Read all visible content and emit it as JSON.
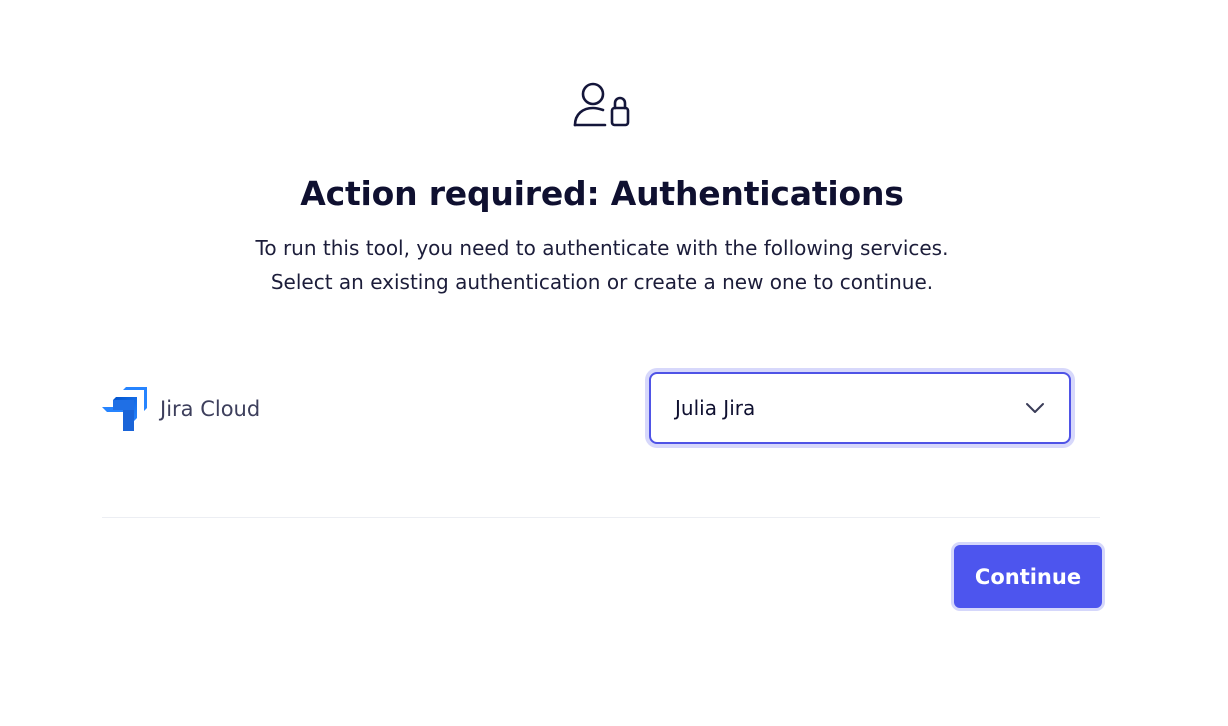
{
  "header": {
    "icon": "user-lock-icon",
    "title": "Action required: Authentications",
    "description_line1": "To run this tool, you need to authenticate with the following services.",
    "description_line2": "Select an existing authentication or create a new one to continue."
  },
  "services": [
    {
      "icon": "jira-logo-icon",
      "name": "Jira Cloud",
      "selected_auth": "Julia Jira"
    }
  ],
  "actions": {
    "continue_label": "Continue"
  },
  "colors": {
    "accent": "#4d55ee",
    "focus_ring": "#d5d7fb",
    "text_primary": "#0f1030",
    "jira_blue": "#2684ff"
  }
}
